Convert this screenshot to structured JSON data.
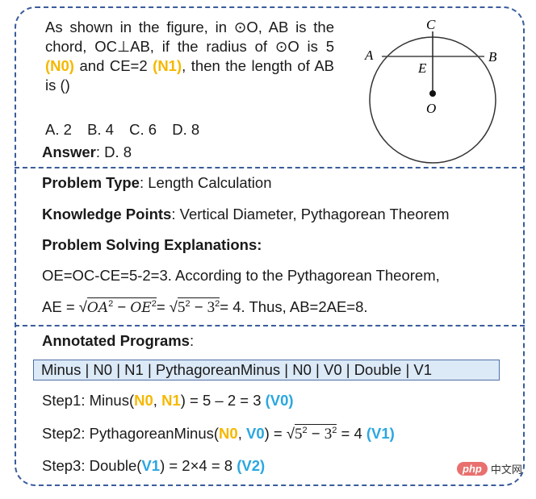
{
  "question": {
    "text_parts": [
      "As shown in the figure, in ⊙O, AB is the chord, OC⊥AB, if the radius of ⊙O is 5 ",
      "(N0)",
      " and CE=2 ",
      "(N1)",
      ", then the length of AB is ()"
    ],
    "options": [
      "A.  2",
      "B.  4",
      "C.  6",
      "D.  8"
    ],
    "answer_label": "Answer",
    "answer_value": ": D. 8"
  },
  "figure": {
    "labels": {
      "A": "A",
      "B": "B",
      "C": "C",
      "E": "E",
      "O": "O"
    }
  },
  "analysis": {
    "problem_type_label": "Problem Type",
    "problem_type_value": ": Length Calculation",
    "knowledge_label": "Knowledge Points",
    "knowledge_value": ": Vertical Diameter, Pythagorean Theorem",
    "explanation_label": "Problem Solving Explanations:",
    "explanation_line1": "OE=OC-CE=5-2=3. According to the Pythagorean Theorem,",
    "explanation_line2": {
      "prefix": "AE = ",
      "sqrt1_a": "OA",
      "minus": " − ",
      "sqrt1_b": "OE",
      "eq": "= ",
      "sqrt2_a": "5",
      "sqrt2_b": "3",
      "exp": "2",
      "suffix": "= 4. Thus, AB=2AE=8."
    }
  },
  "programs": {
    "label": "Annotated Programs",
    "colon": ":",
    "sequence": "Minus | N0 | N1 | PythagoreanMinus | N0 | V0 | Double | V1",
    "steps": [
      {
        "prefix": "Step1: Minus(",
        "arg1": "N0",
        "sep": ", ",
        "arg2": "N1",
        "mid": ") = 5 – 2 = 3 ",
        "result": "(V0)"
      },
      {
        "prefix": "Step2: PythagoreanMinus(",
        "arg1": "N0",
        "sep": ", ",
        "arg2": "V0",
        "mid": ") = ",
        "sqrt_a": "5",
        "sqrt_b": "3",
        "exp": "2",
        "tail": " = 4 ",
        "result": "(V1)"
      },
      {
        "prefix": "Step3: Double(",
        "arg1": "V1",
        "mid": ") = 2×4 = 8 ",
        "result": "(V2)"
      }
    ]
  },
  "watermark": {
    "brand": "php",
    "suffix": "中文网"
  },
  "colors": {
    "frame": "#3a5c9a",
    "number_highlight": "#f5b800",
    "variable_highlight": "#2aa7e0",
    "program_box": "#dce9f7"
  }
}
